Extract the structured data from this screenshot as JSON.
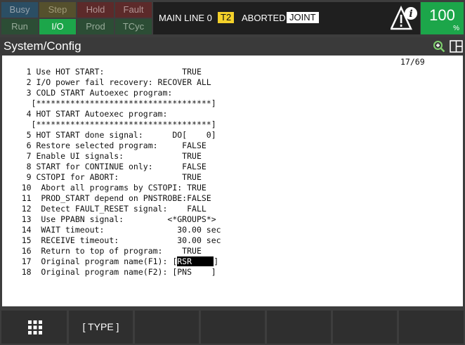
{
  "status_indicators": {
    "busy": "Busy",
    "step": "Step",
    "hold": "Hold",
    "fault": "Fault",
    "run": "Run",
    "io": "I/O",
    "prod": "Prod",
    "tcyc": "TCyc"
  },
  "infobar": {
    "program_line": "MAIN LINE 0",
    "mode_badge": "T2",
    "exec_state": "ABORTED",
    "coord_mode": "JOINT"
  },
  "override": {
    "value": "100",
    "unit": "%"
  },
  "title": "System/Config",
  "page_indicator": "17/69",
  "config_lines": [
    "     1 Use HOT START:                TRUE",
    "     2 I/O power fail recovery: RECOVER ALL",
    "     3 COLD START Autoexec program:",
    "      [************************************]",
    "     4 HOT START Autoexec program:",
    "      [************************************]",
    "     5 HOT START done signal:      DO[    0]",
    "     6 Restore selected program:     FALSE",
    "     7 Enable UI signals:            TRUE",
    "     8 START for CONTINUE only:      FALSE",
    "     9 CSTOPI for ABORT:             TRUE",
    "    10  Abort all programs by CSTOPI: TRUE",
    "    11  PROD_START depend on PNSTROBE:FALSE",
    "    12  Detect FAULT_RESET signal:    FALL",
    "    13  Use PPABN signal:         <*GROUPS*>",
    "    14  WAIT timeout:               30.00 sec",
    "    15  RECEIVE timeout:            30.00 sec",
    "    16  Return to top of program:    TRUE"
  ],
  "line17": {
    "prefix": "    17  Original program name(F1): [",
    "value": "RSR",
    "suffix": "]"
  },
  "line18": "    18  Original program name(F2): [PNS    ]",
  "softkeys": {
    "f1": "[ TYPE ]"
  },
  "colors": {
    "io_active": "#1ca64a",
    "override_bg": "#1ca64a",
    "t2_badge": "#f4d12a"
  }
}
